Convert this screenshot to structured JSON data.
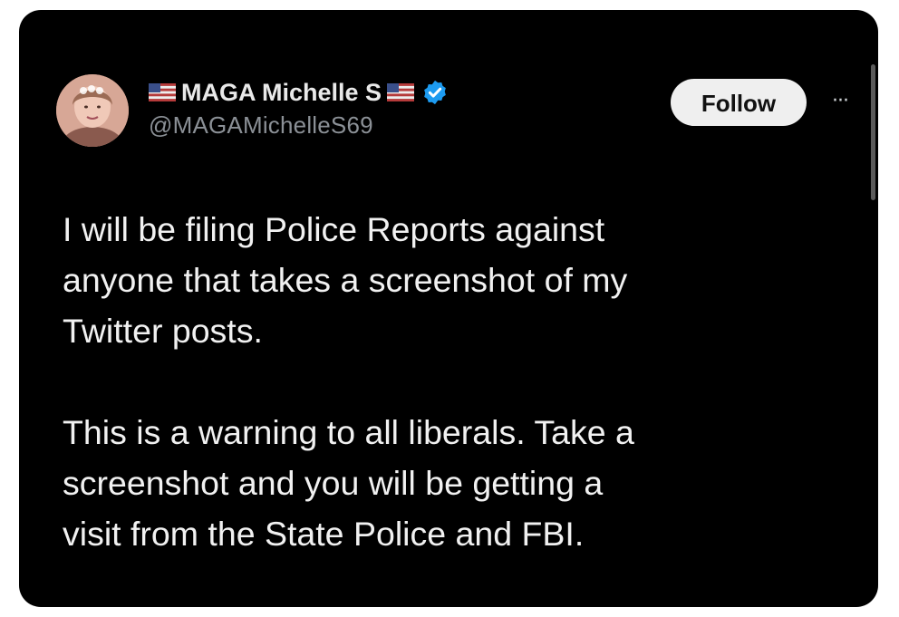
{
  "tweet": {
    "display_name": "MAGA Michelle S",
    "handle": "@MAGAMichelleS69",
    "follow_label": "Follow",
    "more_label": "···",
    "paragraphs": [
      "I will be filing Police Reports against\nanyone that takes a screenshot of my\nTwitter posts.",
      "This is a warning to all liberals. Take a\nscreenshot and you will be getting a\nvisit from the State Police and FBI."
    ],
    "icons": {
      "flag_left": "us-flag-icon",
      "flag_right": "us-flag-icon",
      "verified": "verified-badge-icon",
      "more": "more-options-icon"
    }
  },
  "colors": {
    "card_background": "#000000",
    "name_text": "#e9e9e9",
    "handle_text": "#8b9096",
    "body_text": "#f1f1f1",
    "follow_button_bg": "#efefef",
    "verified_blue": "#1d9bf0"
  }
}
